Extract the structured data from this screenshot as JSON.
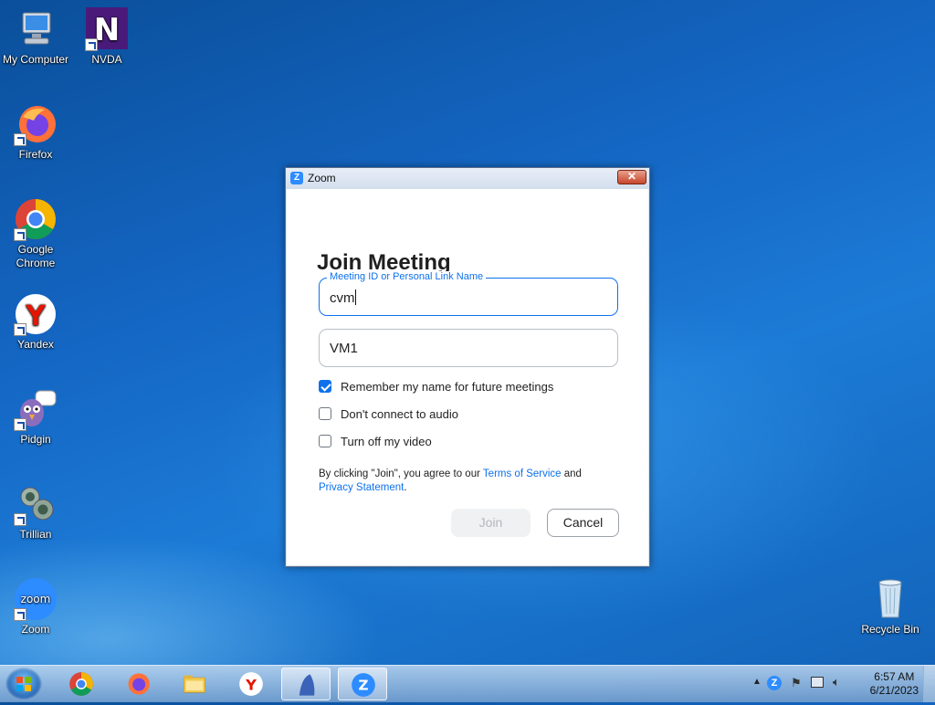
{
  "desktop": {
    "icons": [
      {
        "label": "My Computer"
      },
      {
        "label": "NVDA"
      },
      {
        "label": "Firefox"
      },
      {
        "label": "Google Chrome"
      },
      {
        "label": "Yandex"
      },
      {
        "label": "Pidgin"
      },
      {
        "label": "Trillian"
      },
      {
        "label": "Zoom"
      },
      {
        "label": "Recycle Bin"
      }
    ]
  },
  "dialog": {
    "title": "Zoom",
    "close_label": "✕",
    "heading": "Join Meeting",
    "meeting_id": {
      "legend": "Meeting ID or Personal Link Name",
      "value": "cvm"
    },
    "name_field": {
      "value": "VM1"
    },
    "options": [
      {
        "label": "Remember my name for future meetings",
        "checked": true
      },
      {
        "label": "Don't connect to audio",
        "checked": false
      },
      {
        "label": "Turn off my video",
        "checked": false
      }
    ],
    "terms": {
      "prefix": "By clicking \"Join\", you agree to our ",
      "tos": "Terms of Service",
      "and": " and",
      "privacy": "Privacy Statement",
      "suffix": "."
    },
    "join_label": "Join",
    "cancel_label": "Cancel"
  },
  "taskbar": {
    "items": [
      "chrome-icon",
      "firefox-icon",
      "explorer-icon",
      "yandex-icon",
      "pidgin-icon",
      "zoom-icon"
    ],
    "clock": {
      "time": "6:57 AM",
      "date": "6/21/2023"
    }
  },
  "colors": {
    "accent": "#0e71eb",
    "zoom_brand": "#2d8cff"
  }
}
